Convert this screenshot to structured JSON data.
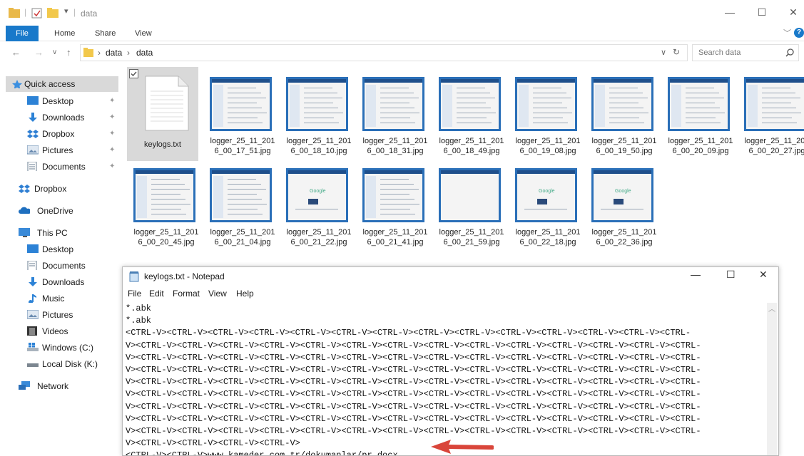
{
  "window": {
    "title": "data",
    "minimize": "—",
    "maximize": "☐",
    "close": "✕",
    "help": "?"
  },
  "ribbon": {
    "file": "File",
    "home": "Home",
    "share": "Share",
    "view": "View",
    "expand": "﹀"
  },
  "address": {
    "segments": [
      "data",
      "data"
    ],
    "separator": "›",
    "refresh": "↻",
    "dropdown": "∨",
    "search_placeholder": "Search data"
  },
  "sidebar": {
    "quick_access": "Quick access",
    "qa_items": [
      "Desktop",
      "Downloads",
      "Dropbox",
      "Pictures",
      "Documents"
    ],
    "dropbox": "Dropbox",
    "onedrive": "OneDrive",
    "this_pc": "This PC",
    "pc_items": [
      "Desktop",
      "Documents",
      "Downloads",
      "Music",
      "Pictures",
      "Videos",
      "Windows (C:)",
      "Local Disk (K:)"
    ],
    "network": "Network"
  },
  "files": [
    {
      "name": "keylogs.txt",
      "kind": "text"
    },
    {
      "name": "logger_25_11_201\n6_00_17_51.jpg",
      "kind": "screen"
    },
    {
      "name": "logger_25_11_201\n6_00_18_10.jpg",
      "kind": "screen"
    },
    {
      "name": "logger_25_11_201\n6_00_18_31.jpg",
      "kind": "screen"
    },
    {
      "name": "logger_25_11_201\n6_00_18_49.jpg",
      "kind": "screen"
    },
    {
      "name": "logger_25_11_201\n6_00_19_08.jpg",
      "kind": "screen"
    },
    {
      "name": "logger_25_11_201\n6_00_19_50.jpg",
      "kind": "screen"
    },
    {
      "name": "logger_25_11_201\n6_00_20_09.jpg",
      "kind": "screen"
    },
    {
      "name": "logger_25_11_201\n6_00_20_27.jpg",
      "kind": "screen"
    },
    {
      "name": "logger_25_11_201\n6_00_20_45.jpg",
      "kind": "screen"
    },
    {
      "name": "logger_25_11_201\n6_00_21_04.jpg",
      "kind": "screen"
    },
    {
      "name": "logger_25_11_201\n6_00_21_22.jpg",
      "kind": "google"
    },
    {
      "name": "logger_25_11_201\n6_00_21_41.jpg",
      "kind": "screen"
    },
    {
      "name": "logger_25_11_201\n6_00_21_59.jpg",
      "kind": "blank"
    },
    {
      "name": "logger_25_11_201\n6_00_22_18.jpg",
      "kind": "google"
    },
    {
      "name": "logger_25_11_201\n6_00_22_36.jpg",
      "kind": "google"
    }
  ],
  "google_word": "Google",
  "notepad": {
    "title": "keylogs.txt - Notepad",
    "menu": [
      "File",
      "Edit",
      "Format",
      "View",
      "Help"
    ],
    "lines": [
      "*.abk",
      "*.abk",
      "<CTRL-V><CTRL-V><CTRL-V><CTRL-V><CTRL-V><CTRL-V><CTRL-V><CTRL-V><CTRL-V><CTRL-V><CTRL-V><CTRL-V><CTRL-V><CTRL-",
      "V><CTRL-V><CTRL-V><CTRL-V><CTRL-V><CTRL-V><CTRL-V><CTRL-V><CTRL-V><CTRL-V><CTRL-V><CTRL-V><CTRL-V><CTRL-V><CTRL-",
      "V><CTRL-V><CTRL-V><CTRL-V><CTRL-V><CTRL-V><CTRL-V><CTRL-V><CTRL-V><CTRL-V><CTRL-V><CTRL-V><CTRL-V><CTRL-V><CTRL-",
      "V><CTRL-V><CTRL-V><CTRL-V><CTRL-V><CTRL-V><CTRL-V><CTRL-V><CTRL-V><CTRL-V><CTRL-V><CTRL-V><CTRL-V><CTRL-V><CTRL-",
      "V><CTRL-V><CTRL-V><CTRL-V><CTRL-V><CTRL-V><CTRL-V><CTRL-V><CTRL-V><CTRL-V><CTRL-V><CTRL-V><CTRL-V><CTRL-V><CTRL-",
      "V><CTRL-V><CTRL-V><CTRL-V><CTRL-V><CTRL-V><CTRL-V><CTRL-V><CTRL-V><CTRL-V><CTRL-V><CTRL-V><CTRL-V><CTRL-V><CTRL-",
      "V><CTRL-V><CTRL-V><CTRL-V><CTRL-V><CTRL-V><CTRL-V><CTRL-V><CTRL-V><CTRL-V><CTRL-V><CTRL-V><CTRL-V><CTRL-V><CTRL-",
      "V><CTRL-V><CTRL-V><CTRL-V><CTRL-V><CTRL-V><CTRL-V><CTRL-V><CTRL-V><CTRL-V><CTRL-V><CTRL-V><CTRL-V><CTRL-V><CTRL-",
      "V><CTRL-V><CTRL-V><CTRL-V><CTRL-V><CTRL-V><CTRL-V><CTRL-V><CTRL-V><CTRL-V><CTRL-V><CTRL-V><CTRL-V><CTRL-V><CTRL-",
      "V><CTRL-V><CTRL-V><CTRL-V><CTRL-V>",
      "<CTRL-V><CTRL-V>www.kameder.com.tr/dokumanlar/pr.docx"
    ]
  },
  "colors": {
    "accent": "#1979ca",
    "selected": "#cce4f7",
    "arrow": "#d9453a"
  }
}
